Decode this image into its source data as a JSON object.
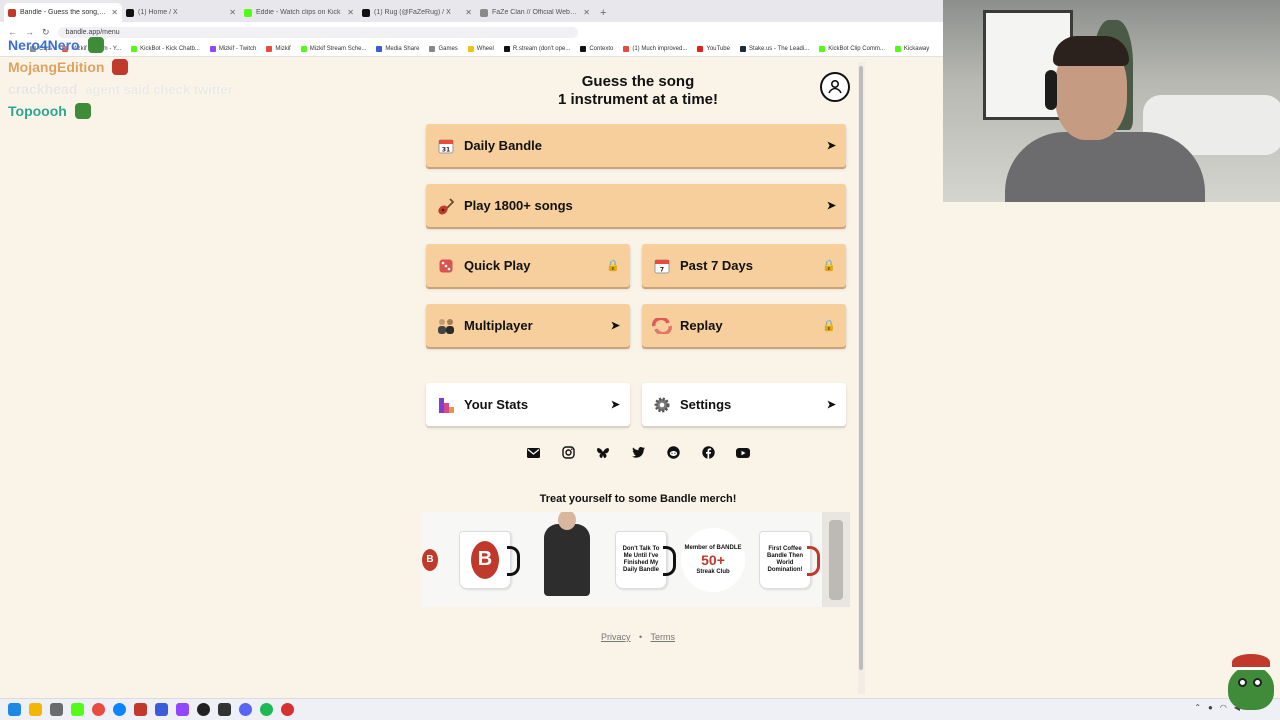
{
  "browser": {
    "tabs": [
      {
        "title": "Bandle - Guess the song, one",
        "color": "#c0392b",
        "active": true
      },
      {
        "title": "(1) Home / X",
        "color": "#111111",
        "active": false
      },
      {
        "title": "Eddie - Watch clips on Kick",
        "color": "#53fc18",
        "active": false
      },
      {
        "title": "(1) Rug (@FaZeRug) / X",
        "color": "#111111",
        "active": false
      },
      {
        "title": "FaZe Clan // Official Website",
        "color": "#8a8a8a",
        "active": false
      }
    ],
    "url": "bandle.app/menu",
    "bookmarks": [
      {
        "label": "Clips",
        "color": "#888888"
      },
      {
        "label": "Mizkif Stream - Y...",
        "color": "#e74c3c"
      },
      {
        "label": "KickBot - Kick Chatb...",
        "color": "#53fc18"
      },
      {
        "label": "Mizkif - Twitch",
        "color": "#9146ff"
      },
      {
        "label": "Mizkif",
        "color": "#e74c3c"
      },
      {
        "label": "Mizkif Stream Sche...",
        "color": "#53fc18"
      },
      {
        "label": "Media Share",
        "color": "#3b5bdb"
      },
      {
        "label": "Games",
        "color": "#888888"
      },
      {
        "label": "Wheel",
        "color": "#f1c40f"
      },
      {
        "label": "R.stream (don't ope...",
        "color": "#111111"
      },
      {
        "label": "Contexto",
        "color": "#111111"
      },
      {
        "label": "(1) Much improved...",
        "color": "#e74c3c"
      },
      {
        "label": "YouTube",
        "color": "#e62117"
      },
      {
        "label": "Stake.us - The Leadi...",
        "color": "#1a2c38"
      },
      {
        "label": "KickBot Clip Comm...",
        "color": "#53fc18"
      },
      {
        "label": "Kickaway",
        "color": "#53fc18"
      }
    ]
  },
  "chat": [
    {
      "user": "Nero4Nero",
      "color": "#3a6fd8",
      "message": ""
    },
    {
      "user": "MojangEdition",
      "color": "#e0a15a",
      "message": ""
    },
    {
      "user": "crackhead",
      "color": "#e9e6df",
      "message": "agent said check twitter"
    },
    {
      "user": "Topoooh",
      "color": "#2fa58e",
      "message": ""
    }
  ],
  "app": {
    "title_line1": "Guess the song",
    "title_line2": "1 instrument at a time!",
    "buttons": {
      "daily": "Daily Bandle",
      "play_songs": "Play 1800+ songs",
      "quick_play": "Quick Play",
      "past_days": "Past 7 Days",
      "multiplayer": "Multiplayer",
      "replay": "Replay",
      "stats": "Your Stats",
      "settings": "Settings"
    },
    "daily_icon_day": "31",
    "past_icon_day": "7",
    "merch_title": "Treat yourself to some Bandle merch!",
    "merch": {
      "mug2_text": "Don't Talk To Me Until I've Finished My Daily Bandle",
      "seal_top": "Member of BANDLE",
      "seal_num": "50+",
      "seal_bottom": "Streak Club",
      "mug3_text": "First Coffee Bandle Then World Domination!"
    },
    "footer": {
      "privacy": "Privacy",
      "sep": "•",
      "terms": "Terms"
    }
  },
  "colors": {
    "page_bg": "#faf3e8",
    "button_peach": "#f6cf9c",
    "lock": "#c98c00"
  }
}
